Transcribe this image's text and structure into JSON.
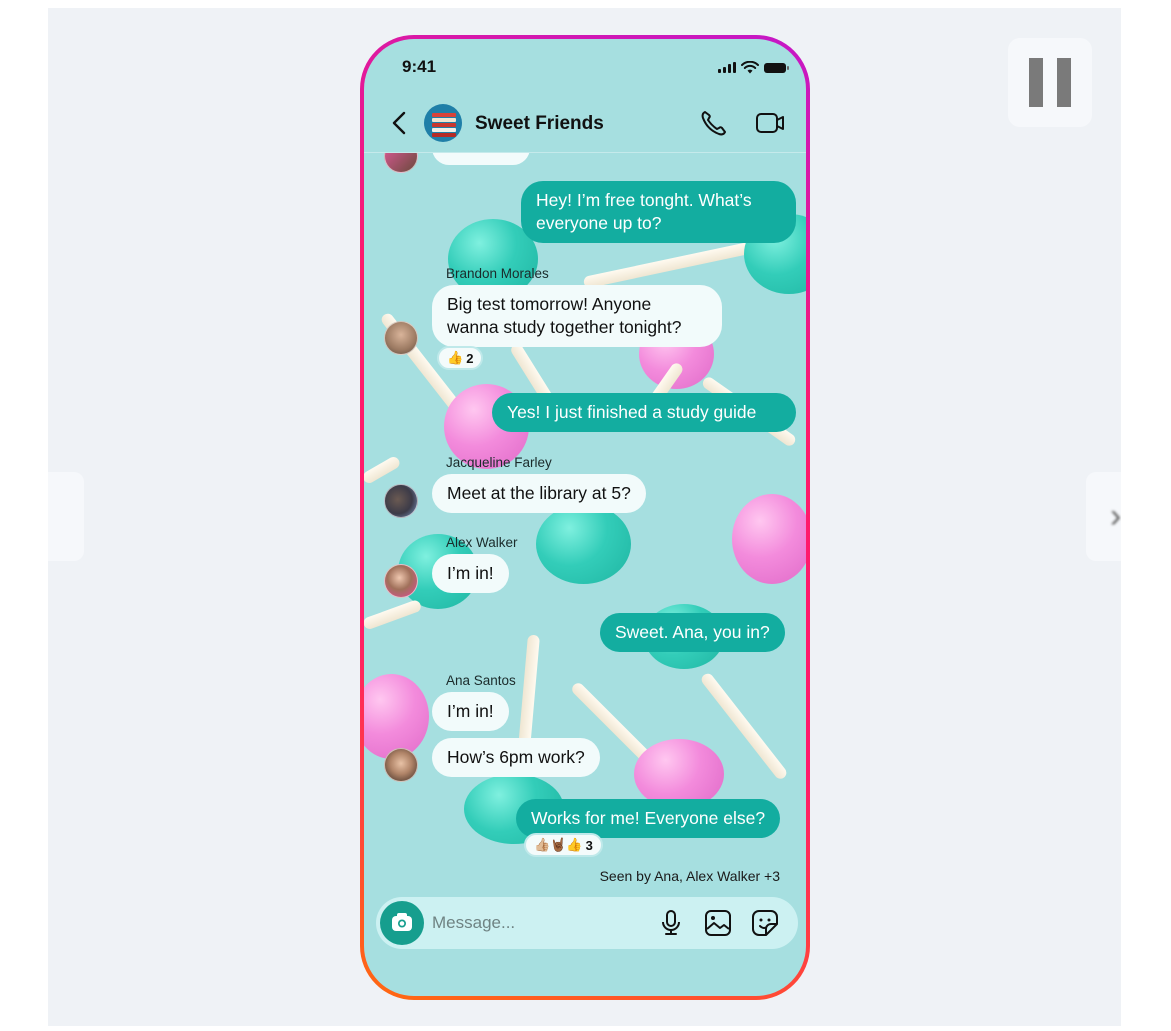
{
  "controls": {
    "pause_icon": "pause-icon",
    "prev_icon": "chevron-left-icon",
    "next_icon": "chevron-right-icon",
    "prev_glyph": "‹",
    "next_glyph": "›"
  },
  "status_bar": {
    "time": "9:41",
    "icons": [
      "signal-icon",
      "wifi-icon",
      "battery-icon"
    ]
  },
  "header": {
    "title": "Sweet Friends",
    "back_icon": "chevron-left-icon",
    "call_icon": "phone-icon",
    "video_icon": "video-camera-icon"
  },
  "messages": [
    {
      "id": "m1",
      "direction": "out",
      "text": "Hey! I’m free tonght. What’s everyone up to?"
    },
    {
      "id": "m2",
      "direction": "in",
      "sender": "Brandon Morales",
      "text": "Big test tomorrow! Anyone wanna study together tonight?",
      "reaction": {
        "emojis": "👍",
        "count": "2"
      }
    },
    {
      "id": "m3",
      "direction": "out",
      "text": "Yes! I just finished a study guide"
    },
    {
      "id": "m4",
      "direction": "in",
      "sender": "Jacqueline Farley",
      "text": "Meet at the library at 5?"
    },
    {
      "id": "m5",
      "direction": "in",
      "sender": "Alex Walker",
      "text": "I’m in!"
    },
    {
      "id": "m6",
      "direction": "out",
      "text": "Sweet. Ana, you in?"
    },
    {
      "id": "m7",
      "direction": "in",
      "sender": "Ana Santos",
      "text": "I’m in!"
    },
    {
      "id": "m8",
      "direction": "in",
      "text": "How’s 6pm work?"
    },
    {
      "id": "m9",
      "direction": "out",
      "text": "Works for me! Everyone else?",
      "reaction": {
        "emojis": "👍🏼🤘🏾👍",
        "count": "3"
      }
    }
  ],
  "seen_text": "Seen by Ana, Alex Walker +3",
  "composer": {
    "placeholder": "Message...",
    "camera_icon": "camera-icon",
    "mic_icon": "microphone-icon",
    "gallery_icon": "image-icon",
    "sticker_icon": "sticker-icon"
  },
  "colors": {
    "outgoing_bubble": "#13ada0",
    "incoming_bubble": "#f2fbfb",
    "chat_background": "#a6dfe0",
    "frame_gradient": [
      "#c418c8",
      "#ff1a6c",
      "#ff6a10"
    ]
  }
}
